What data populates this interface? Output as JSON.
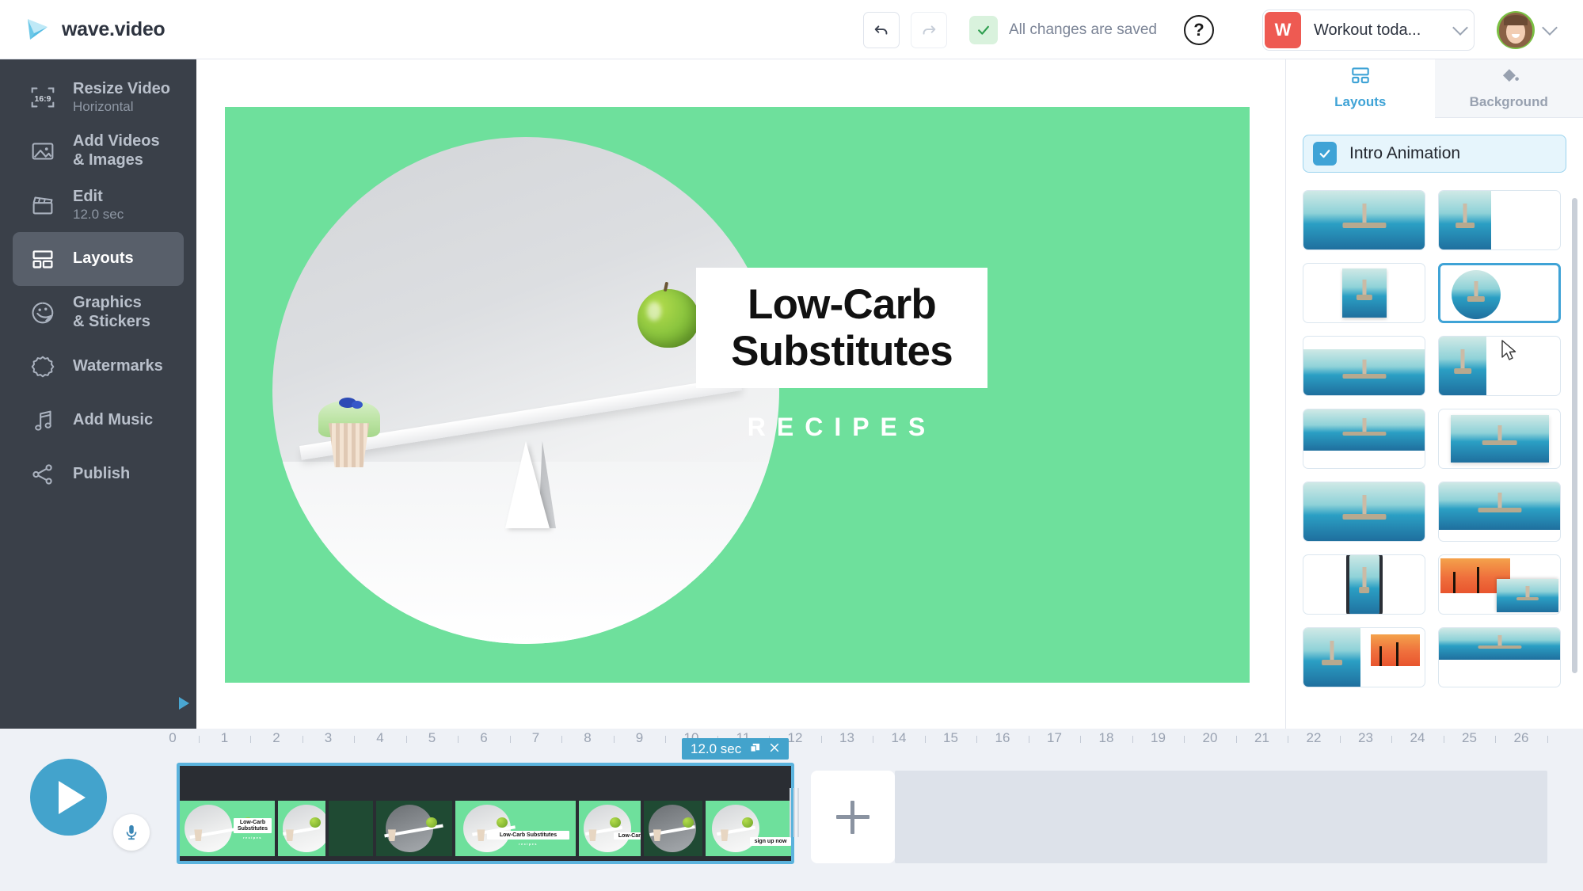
{
  "app": {
    "brand": "wave.video"
  },
  "topbar": {
    "undo_icon": "undo-arrow-icon",
    "redo_icon": "redo-arrow-icon",
    "save_status": "All changes are saved",
    "help_label": "?",
    "project_badge": "W",
    "project_name": "Workout toda..."
  },
  "sidebar": {
    "items": [
      {
        "title": "Resize Video",
        "sub": "Horizontal",
        "icon": "aspect-ratio-16-9-icon",
        "active": false
      },
      {
        "title": "Add Videos\n& Images",
        "sub": "",
        "icon": "image-icon",
        "active": false
      },
      {
        "title": "Edit",
        "sub": "12.0 sec",
        "icon": "clapperboard-icon",
        "active": false
      },
      {
        "title": "Layouts",
        "sub": "",
        "icon": "layouts-grid-icon",
        "active": true
      },
      {
        "title": "Graphics\n& Stickers",
        "sub": "",
        "icon": "sticker-smiley-icon",
        "active": false
      },
      {
        "title": "Watermarks",
        "sub": "",
        "icon": "badge-seal-icon",
        "active": false
      },
      {
        "title": "Add Music",
        "sub": "",
        "icon": "music-note-icon",
        "active": false
      },
      {
        "title": "Publish",
        "sub": "",
        "icon": "share-icon",
        "active": false
      }
    ],
    "aspect_label": "16:9",
    "collapse_icon": "play-triangle-icon"
  },
  "canvas": {
    "background_color": "#6ee09c",
    "title_line1": "Low-Carb",
    "title_line2": "Substitutes",
    "subtitle": "RECIPES",
    "title_box_color": "#ffffff",
    "title_text_color": "#111111",
    "subtitle_color": "#ffffff",
    "image_alt": "seesaw-cupcake-apple-circle"
  },
  "right_panel": {
    "tabs": [
      {
        "label": "Layouts",
        "icon": "layouts-grid-icon",
        "active": true
      },
      {
        "label": "Background",
        "icon": "paint-bucket-icon",
        "active": false
      }
    ],
    "intro_animation": {
      "label": "Intro Animation",
      "checked": true
    },
    "accent_color": "#3fa3d6",
    "layout_thumbs": [
      {
        "kind": "full",
        "selected": false
      },
      {
        "kind": "square-left",
        "selected": false
      },
      {
        "kind": "square-center-small",
        "selected": false
      },
      {
        "kind": "circle-left",
        "selected": true
      },
      {
        "kind": "wide-top",
        "selected": false
      },
      {
        "kind": "tall-left",
        "selected": false
      },
      {
        "kind": "top-band",
        "selected": false
      },
      {
        "kind": "inset-wide",
        "selected": false
      },
      {
        "kind": "full-bleed",
        "selected": false
      },
      {
        "kind": "upper-wide",
        "selected": false
      },
      {
        "kind": "phone-mockup",
        "selected": false
      },
      {
        "kind": "two-image-overlap",
        "selected": false
      },
      {
        "kind": "split-pair",
        "selected": false
      },
      {
        "kind": "band-top",
        "selected": false
      }
    ]
  },
  "timeline": {
    "ruler_ticks": [
      "0",
      "1",
      "2",
      "3",
      "4",
      "5",
      "6",
      "7",
      "8",
      "9",
      "10",
      "11",
      "12",
      "13",
      "14",
      "15",
      "16",
      "17",
      "18",
      "19",
      "20",
      "21",
      "22",
      "23",
      "24",
      "25",
      "26"
    ],
    "clip_duration": "12.0 sec",
    "clip_duplicate_icon": "duplicate-icon",
    "clip_close_icon": "close-x-icon",
    "play_icon": "play-icon",
    "mic_icon": "microphone-icon",
    "add_icon": "plus-icon",
    "frames": [
      {
        "label": "Low-Carb\nSubstitutes",
        "sub": "recipes",
        "dim": false
      },
      {
        "label": "",
        "sub": "",
        "dim": false
      },
      {
        "label": "",
        "sub": "",
        "dim": true
      },
      {
        "label": "Low-Carb Substitutes",
        "sub": "recipes",
        "dim": false
      },
      {
        "label": "Low-Carb",
        "sub": "rec",
        "dim": false
      },
      {
        "label": "",
        "sub": "",
        "dim": true
      },
      {
        "label": "sign up now",
        "sub": "",
        "dim": false
      },
      {
        "label": "si",
        "sub": "",
        "dim": false
      }
    ]
  }
}
